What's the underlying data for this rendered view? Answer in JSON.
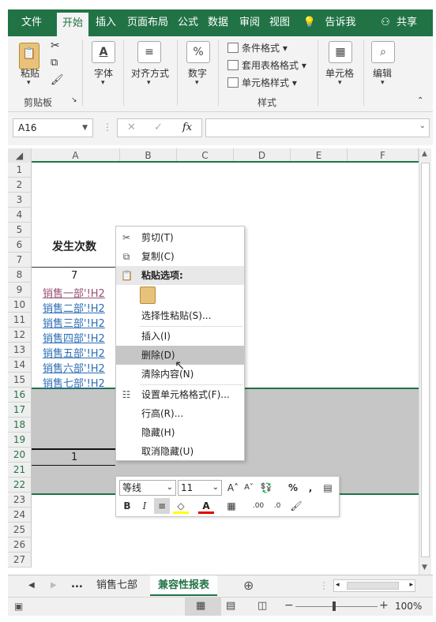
{
  "ribbon_tabs": [
    "文件",
    "开始",
    "插入",
    "页面布局",
    "公式",
    "数据",
    "审阅",
    "视图",
    "告诉我",
    "共享"
  ],
  "clipboard": {
    "paste": "粘贴",
    "group": "剪贴板"
  },
  "groups": {
    "font": "字体",
    "align": "对齐方式",
    "number": "数字",
    "cells": "单元格",
    "edit": "编辑",
    "styles": "样式"
  },
  "styles_items": [
    "条件格式",
    "套用表格格式",
    "单元格样式"
  ],
  "name_box": "A16",
  "fx_label": "fx",
  "columns": [
    "A",
    "B",
    "C",
    "D",
    "E",
    "F"
  ],
  "rows": [
    "1",
    "2",
    "3",
    "4",
    "5",
    "6",
    "7",
    "8",
    "9",
    "10",
    "11",
    "12",
    "13",
    "14",
    "15",
    "16",
    "17",
    "18",
    "19",
    "20",
    "21",
    "22",
    "23",
    "24",
    "25",
    "26",
    "27"
  ],
  "cells": {
    "header": "发生次数",
    "count": "7",
    "links": [
      "销售一部'!H2",
      "销售二部'!H2",
      "销售三部'!H2",
      "销售四部'!H2",
      "销售五部'!H2",
      "销售六部'!H2",
      "销售七部'!H2"
    ],
    "r20": "1"
  },
  "context_menu": {
    "cut": "剪切(T)",
    "copy": "复制(C)",
    "paste_options": "粘贴选项:",
    "paste_special": "选择性粘贴(S)...",
    "insert": "插入(I)",
    "delete": "删除(D)",
    "clear": "清除内容(N)",
    "format_cells": "设置单元格格式(F)...",
    "row_height": "行高(R)...",
    "hide": "隐藏(H)",
    "unhide": "取消隐藏(U)"
  },
  "mini_toolbar": {
    "font": "等线",
    "size": "11",
    "bold": "B",
    "italic": "I",
    "percent": "%",
    "comma": ","
  },
  "sheet_tabs": {
    "ellipsis": "...",
    "prev": "销售七部",
    "active": "兼容性报表"
  },
  "zoom": "100%",
  "colors": {
    "accent": "#217346",
    "selection": "#c6c6c6"
  }
}
